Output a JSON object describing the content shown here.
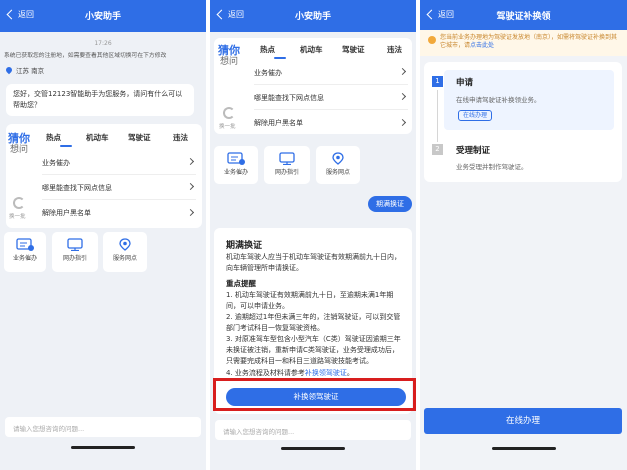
{
  "common": {
    "back_label": "返回",
    "input_placeholder": "请输入您想咨询的问题..."
  },
  "screen1": {
    "title": "小安助手",
    "time": "17:26",
    "notice": "系统已获取您的注册地，如需要查看其他区域切换可在下方修改",
    "location": "江苏 南京",
    "greeting": "您好，交管12123智能助手为您服务，请问有什么可以帮助您？",
    "side_big": "猜你",
    "side_small": "想问",
    "refresh_label": "换一批",
    "tabs": [
      "热点",
      "机动车",
      "驾驶证",
      "违法"
    ],
    "items": [
      "业务催办",
      "哪里能查找下网点信息",
      "解除用户黑名单"
    ],
    "services": [
      "业务催办",
      "网办指引",
      "服务网点"
    ]
  },
  "screen2": {
    "title": "小安助手",
    "side_big": "猜你",
    "side_small": "想问",
    "refresh_label": "换一批",
    "tabs": [
      "热点",
      "机动车",
      "驾驶证",
      "违法"
    ],
    "items": [
      "业务催办",
      "哪里能查找下网点信息",
      "解除用户黑名单"
    ],
    "services": [
      "业务催办",
      "网办指引",
      "服务网点"
    ],
    "user_chip": "期满换证",
    "answer_title": "期满换证",
    "answer_intro": "机动车驾驶人应当于机动车驾驶证有效期满前九十日内，向车辆管理所申请换证。",
    "key_title": "重点提醒",
    "points": [
      "1. 机动车驾驶证有效期满前九十日，至逾期未满1年期间，可以申请业务。",
      "2. 逾期超过1年但未满三年的，注销驾驶证，可以到交管部门考试科目一恢复驾驶资格。",
      "3. 对原准驾车型包含小型汽车（C类）驾驶证因逾期三年未换证被注销，重新申请C类驾驶证，业务受理成功后，只需要完成科目一和科目三道路驾驶技能考试。"
    ],
    "point4_prefix": "4. 业务流程及材料请参考",
    "point4_link": "补换领驾驶证",
    "point4_suffix": "。",
    "action_button": "补换领驾驶证"
  },
  "screen3": {
    "title": "驾驶证补换领",
    "tip_text": "您当前业务办理地为驾驶证发放地（南京），如需将驾驶证补换到其它城市，请",
    "tip_link": "点击此处",
    "steps": [
      {
        "num": "1",
        "title": "申请",
        "desc": "在线申请驾驶证补换领业务。",
        "button": "在线办理"
      },
      {
        "num": "2",
        "title": "受理制证",
        "desc": "业务受理并制作驾驶证。"
      }
    ],
    "apply_button": "在线办理"
  },
  "colors": {
    "primary": "#2f6ee6",
    "highlight_border": "#d81e1e",
    "tip_bg": "#fff7e8",
    "tip_text": "#c8862c"
  }
}
